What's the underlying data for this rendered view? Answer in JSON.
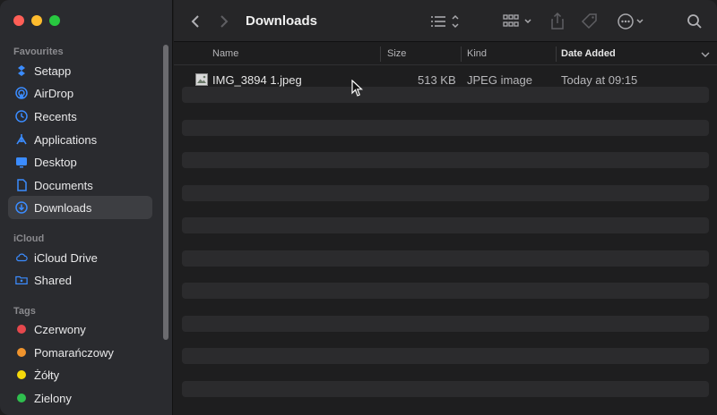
{
  "window": {
    "title": "Downloads"
  },
  "sidebar": {
    "favourites_title": "Favourites",
    "favourites": [
      {
        "label": "Setapp",
        "icon": "setapp-icon"
      },
      {
        "label": "AirDrop",
        "icon": "airdrop-icon"
      },
      {
        "label": "Recents",
        "icon": "recents-icon"
      },
      {
        "label": "Applications",
        "icon": "applications-icon"
      },
      {
        "label": "Desktop",
        "icon": "desktop-icon"
      },
      {
        "label": "Documents",
        "icon": "document-icon"
      },
      {
        "label": "Downloads",
        "icon": "downloads-icon",
        "selected": true
      }
    ],
    "icloud_title": "iCloud",
    "icloud": [
      {
        "label": "iCloud Drive",
        "icon": "cloud-icon"
      },
      {
        "label": "Shared",
        "icon": "shared-folder-icon"
      }
    ],
    "tags_title": "Tags",
    "tags": [
      {
        "label": "Czerwony",
        "color": "#e5484d"
      },
      {
        "label": "Pomarańczowy",
        "color": "#f0942d"
      },
      {
        "label": "Żółty",
        "color": "#f5d90a"
      },
      {
        "label": "Zielony",
        "color": "#2fbf4e"
      }
    ]
  },
  "columns": {
    "name": "Name",
    "size": "Size",
    "kind": "Kind",
    "date_added": "Date Added"
  },
  "files": [
    {
      "name": "IMG_3894 1.jpeg",
      "size": "513 KB",
      "kind": "JPEG image",
      "date_added": "Today at 09:15"
    }
  ]
}
